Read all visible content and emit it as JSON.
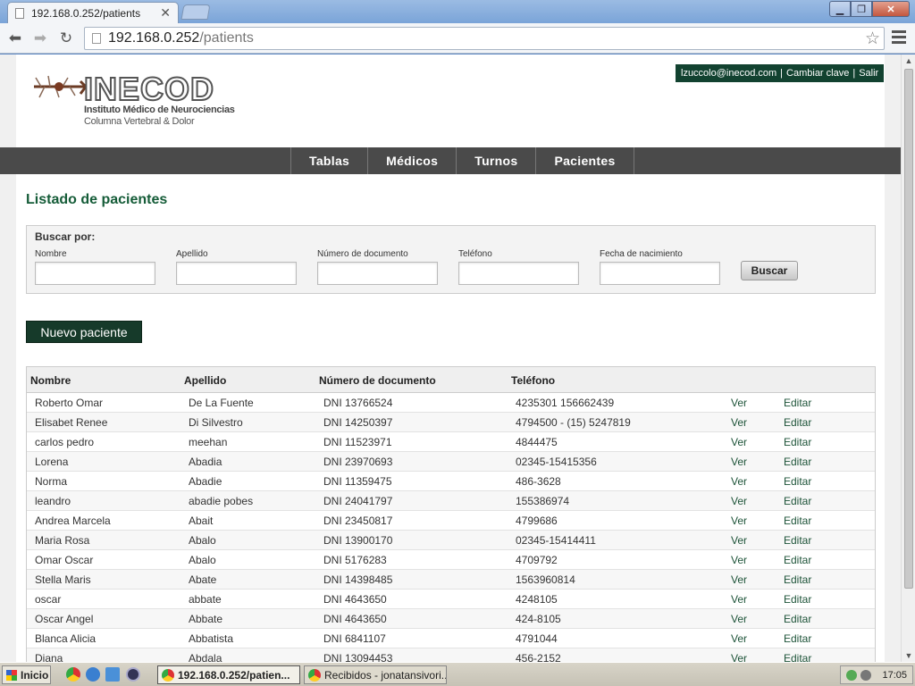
{
  "browser": {
    "tab_title": "192.168.0.252/patients",
    "url_host": "192.168.0.252",
    "url_path": "/patients"
  },
  "header": {
    "brand": "INECOD",
    "tagline1": "Instituto Médico de Neurociencias",
    "tagline2": "Columna Vertebral & Dolor",
    "user_email": "lzuccolo@inecod.com",
    "change_password": "Cambiar clave",
    "logout": "Salir",
    "separator": "|"
  },
  "nav": {
    "items": [
      "Tablas",
      "Médicos",
      "Turnos",
      "Pacientes"
    ]
  },
  "page": {
    "title": "Listado de pacientes"
  },
  "search": {
    "heading": "Buscar por:",
    "fields": [
      "Nombre",
      "Apellido",
      "Número de documento",
      "Teléfono",
      "Fecha de nacimiento"
    ],
    "button": "Buscar"
  },
  "new_patient_button": "Nuevo paciente",
  "table": {
    "headers": [
      "Nombre",
      "Apellido",
      "Número de documento",
      "Teléfono"
    ],
    "view_label": "Ver",
    "edit_label": "Editar",
    "rows": [
      [
        "Roberto Omar",
        "De La Fuente",
        "DNI 13766524",
        "4235301 156662439"
      ],
      [
        "Elisabet Renee",
        "Di Silvestro",
        "DNI 14250397",
        "4794500 - (15) 5247819"
      ],
      [
        "carlos pedro",
        "meehan",
        "DNI 11523971",
        "4844475"
      ],
      [
        "Lorena",
        "Abadia",
        "DNI 23970693",
        "02345-15415356"
      ],
      [
        "Norma",
        "Abadie",
        "DNI 11359475",
        "486-3628"
      ],
      [
        "leandro",
        "abadie pobes",
        "DNI 24041797",
        "155386974"
      ],
      [
        "Andrea Marcela",
        "Abait",
        "DNI 23450817",
        "4799686"
      ],
      [
        "Maria Rosa",
        "Abalo",
        "DNI 13900170",
        "02345-15414411"
      ],
      [
        "Omar Oscar",
        "Abalo",
        "DNI 5176283",
        "4709792"
      ],
      [
        "Stella Maris",
        "Abate",
        "DNI 14398485",
        "1563960814"
      ],
      [
        "oscar",
        "abbate",
        "DNI 4643650",
        "4248105"
      ],
      [
        "Oscar Angel",
        "Abbate",
        "DNI 4643650",
        "424-8105"
      ],
      [
        "Blanca Alicia",
        "Abbatista",
        "DNI 6841107",
        "4791044"
      ],
      [
        "Diana",
        "Abdala",
        "DNI 13094453",
        "456-2152"
      ]
    ]
  },
  "taskbar": {
    "start": "Inicio",
    "tasks": [
      "192.168.0.252/patien...",
      "Recibidos - jonatansivori..."
    ],
    "clock": "17:05"
  },
  "icons": {
    "back": "arrow-left",
    "forward": "arrow-right",
    "reload": "reload",
    "bookmark": "star-outline",
    "menu": "hamburger"
  },
  "colors": {
    "brand_green": "#155c38",
    "dark_green": "#124230",
    "nav_bg": "#4a4a4a"
  }
}
